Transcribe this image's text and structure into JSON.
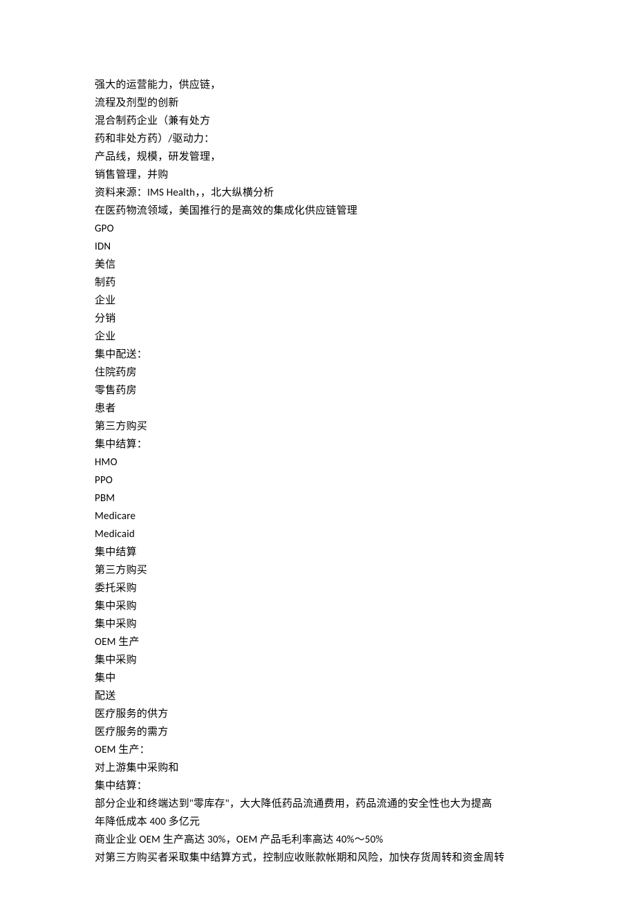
{
  "lines": [
    "强大的运营能力，供应链，",
    "流程及剂型的创新",
    "混合制药企业（兼有处方",
    "药和非处方药）/驱动力：",
    "产品线，规模，研发管理，",
    "销售管理，并购",
    "资料来源：IMS Health，，北大纵横分析",
    "在医药物流领域，美国推行的是高效的集成化供应链管理",
    "GPO",
    "IDN",
    "美信",
    "制药",
    "企业",
    "分销",
    "企业",
    "集中配送：",
    "住院药房",
    "零售药房",
    "患者",
    "第三方购买",
    "集中结算：",
    "HMO",
    "PPO",
    "PBM",
    "Medicare",
    "Medicaid",
    "集中结算",
    "第三方购买",
    "委托采购",
    "集中采购",
    "集中采购",
    "OEM 生产",
    "集中采购",
    "集中",
    "配送",
    "医疗服务的供方",
    "医疗服务的需方",
    "OEM 生产：",
    "对上游集中采购和",
    "集中结算：",
    "部分企业和终端达到\"零库存\"，大大降低药品流通费用，药品流通的安全性也大为提高",
    "年降低成本 400 多亿元",
    "商业企业 OEM 生产高达 30%，OEM 产品毛利率高达 40%～50%",
    "对第三方购买者采取集中结算方式，控制应收账款帐期和风险，加快存货周转和资金周转"
  ]
}
